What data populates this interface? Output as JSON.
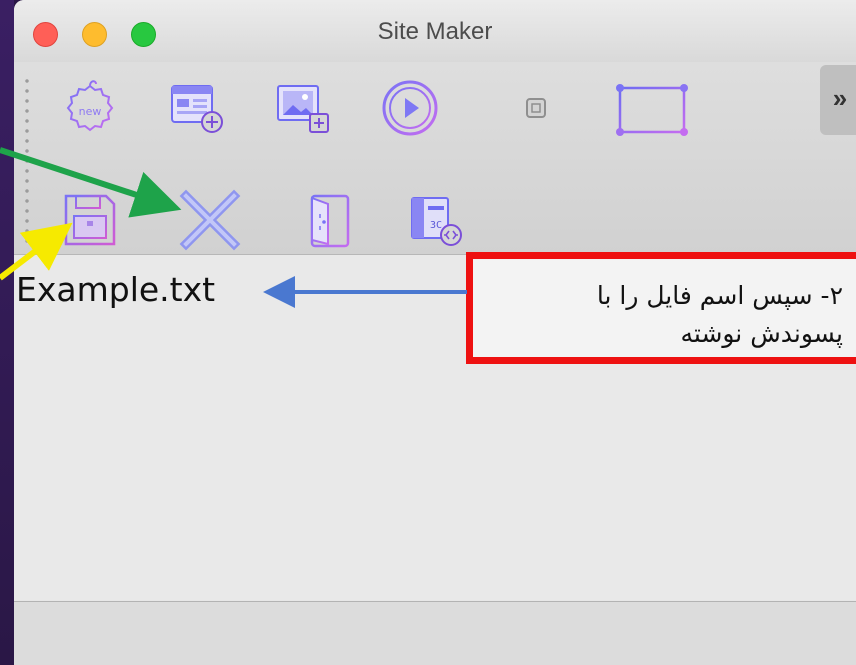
{
  "window": {
    "title": "Site Maker"
  },
  "toolbar": {
    "row1": [
      {
        "icon": "new-badge-icon",
        "label": "new"
      },
      {
        "icon": "add-page-icon"
      },
      {
        "icon": "add-image-icon"
      },
      {
        "icon": "play-video-icon"
      },
      {
        "icon": "small-box-icon"
      },
      {
        "icon": "rectangle-select-icon"
      }
    ],
    "row2": [
      {
        "icon": "save-disk-icon"
      },
      {
        "icon": "close-x-icon"
      },
      {
        "icon": "door-exit-icon"
      },
      {
        "icon": "code-file-icon"
      }
    ],
    "overflow_label": "»"
  },
  "content": {
    "filename_text": "Example.txt"
  },
  "annotation": {
    "line1": "۲- سپس اسم فایل را با",
    "line2": "پسوندش نوشته",
    "border_color": "#ee1111"
  },
  "arrows": {
    "green": "#1ea34a",
    "yellow": "#f6ea00",
    "blue": "#4a78d0"
  },
  "accent": {
    "icon_blue": "#6f6cf2",
    "icon_purple": "#b45bef"
  }
}
